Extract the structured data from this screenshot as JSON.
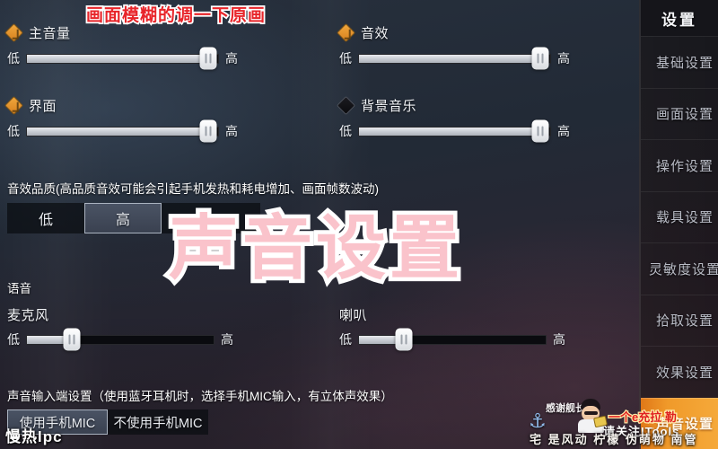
{
  "sidebar": {
    "header": "设置",
    "items": [
      {
        "label": "基础设置",
        "active": false
      },
      {
        "label": "画面设置",
        "active": false
      },
      {
        "label": "操作设置",
        "active": false
      },
      {
        "label": "载具设置",
        "active": false
      },
      {
        "label": "灵敏度设置",
        "active": false
      },
      {
        "label": "拾取设置",
        "active": false
      },
      {
        "label": "效果设置",
        "active": false
      },
      {
        "label": "声音设置",
        "active": true
      }
    ],
    "active_color": "#f0982a"
  },
  "sliders": {
    "low_label": "低",
    "high_label": "高",
    "items": [
      {
        "name": "主音量",
        "enabled": true,
        "value": 95
      },
      {
        "name": "音效",
        "enabled": true,
        "value": 95
      },
      {
        "name": "界面",
        "enabled": true,
        "value": 95
      },
      {
        "name": "背景音乐",
        "enabled": false,
        "value": 95
      }
    ]
  },
  "audio_quality": {
    "title": "音效品质(高品质音效可能会引起手机发热和耗电增加、画面帧数波动)",
    "options": [
      {
        "label": "低",
        "selected": false
      },
      {
        "label": "高",
        "selected": true
      },
      {
        "label": "",
        "selected": false
      }
    ]
  },
  "voice": {
    "section_label": "语音",
    "low_label": "低",
    "high_label": "高",
    "items": [
      {
        "name": "麦克风",
        "value": 24
      },
      {
        "name": "喇叭",
        "value": 24
      }
    ]
  },
  "input_device": {
    "title": "声音输入端设置（使用蓝牙耳机时，选择手机MIC输入，有立体声效果）",
    "options": [
      {
        "label": "使用手机MIC",
        "selected": true
      },
      {
        "label": "不使用手机MIC",
        "selected": false
      }
    ]
  },
  "overlays": {
    "top_banner": "画面模糊的调一下原画",
    "big_title": "声音设置",
    "watermark_left": "慢热lpc",
    "thanks": "感谢舰长",
    "bottom_line": "宅 是风动 柠檬 伪萌物 南管",
    "red_text": "一个e充拉 勒",
    "follow_text": "请关注ITools",
    "anchor_icon": "⚓"
  },
  "colors": {
    "accent_orange": "#f0a63c",
    "panel_bg": "#232c3a",
    "title_pink": "#fac3cb",
    "banner_red": "#e8252a"
  }
}
